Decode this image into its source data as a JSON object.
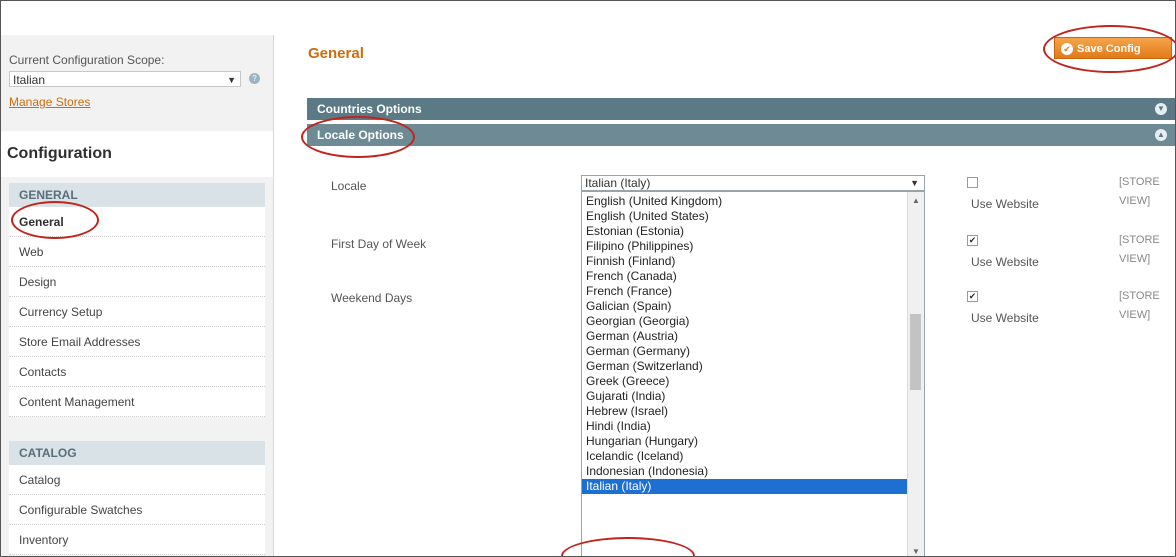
{
  "sidebar": {
    "scope_label": "Current Configuration Scope:",
    "scope_value": "Italian",
    "manage_stores": "Manage Stores",
    "config_title": "Configuration",
    "general_section": {
      "heading": "GENERAL",
      "items": [
        "General",
        "Web",
        "Design",
        "Currency Setup",
        "Store Email Addresses",
        "Contacts",
        "Content Management"
      ]
    },
    "catalog_section": {
      "heading": "CATALOG",
      "items": [
        "Catalog",
        "Configurable Swatches",
        "Inventory"
      ]
    }
  },
  "main": {
    "title": "General",
    "save_button": "Save Config",
    "sections": {
      "countries": "Countries Options",
      "locale": "Locale Options"
    },
    "fields": {
      "locale": "Locale",
      "first_day": "First Day of Week",
      "weekend": "Weekend Days"
    },
    "locale_value": "Italian (Italy)",
    "use_website": "Use Website",
    "scope_tag_line1": "[STORE",
    "scope_tag_line2": "VIEW]",
    "locale_options": [
      "English (United Kingdom)",
      "English (United States)",
      "Estonian (Estonia)",
      "Filipino (Philippines)",
      "Finnish (Finland)",
      "French (Canada)",
      "French (France)",
      "Galician (Spain)",
      "Georgian (Georgia)",
      "German (Austria)",
      "German (Germany)",
      "German (Switzerland)",
      "Greek (Greece)",
      "Gujarati (India)",
      "Hebrew (Israel)",
      "Hindi (India)",
      "Hungarian (Hungary)",
      "Icelandic (Iceland)",
      "Indonesian (Indonesia)",
      "Italian (Italy)"
    ]
  },
  "colors": {
    "accent_orange": "#e27b17",
    "section_bar": "#5b7a86",
    "highlight_blue": "#1e6fd2",
    "callout_red": "#c0241d"
  }
}
